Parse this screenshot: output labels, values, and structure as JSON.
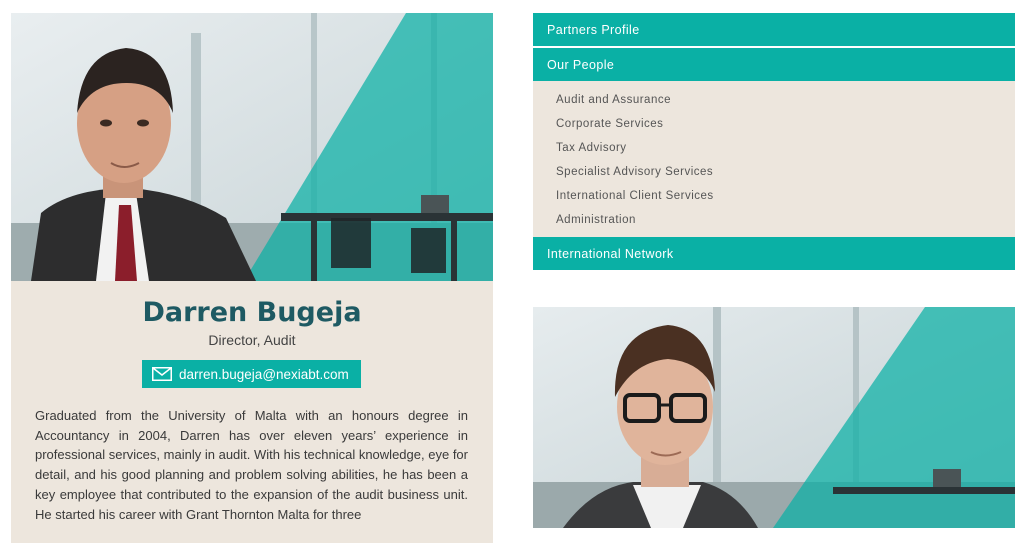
{
  "profile": {
    "name": "Darren Bugeja",
    "role": "Director, Audit",
    "email": "darren.bugeja@nexiabt.com",
    "email_icon": "envelope-icon",
    "bio": "Graduated from the University of Malta with an honours degree in Accountancy in 2004, Darren has over eleven years’ experience in professional services, mainly in audit. With his technical knowledge, eye for detail, and his good planning and problem solving abilities, he has been a key employee that contributed to the expansion of the audit business unit. He started his career with Grant Thornton Malta for three"
  },
  "menu": {
    "partners_profile": "Partners Profile",
    "our_people": "Our People",
    "sub_items": [
      "Audit and Assurance",
      "Corporate Services",
      "Tax Advisory",
      "Specialist Advisory Services",
      "International Client Services",
      "Administration"
    ],
    "international_network": "International Network"
  },
  "colors": {
    "accent": "#0ab0a5",
    "panel": "#ede6dd",
    "name_text": "#1e5a63"
  }
}
